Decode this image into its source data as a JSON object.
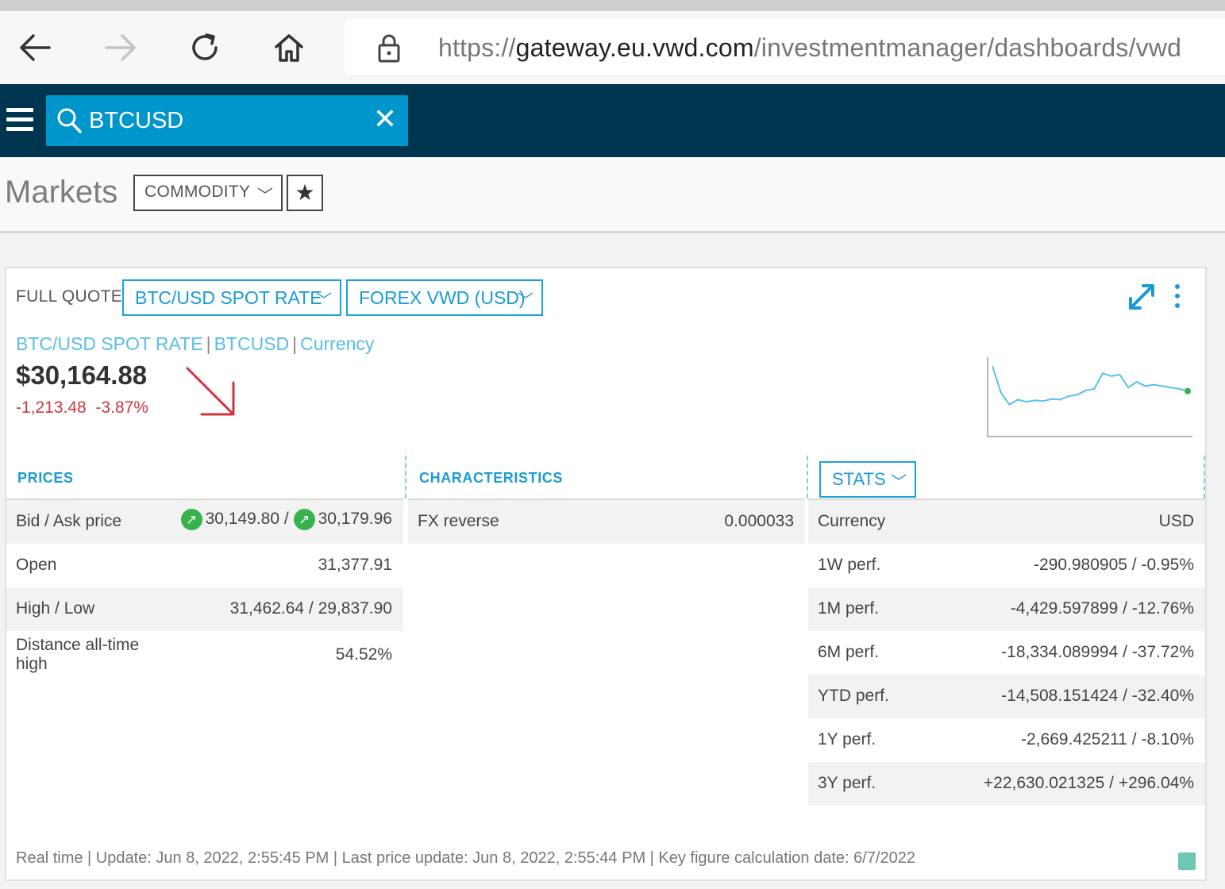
{
  "browser": {
    "url_scheme": "https://",
    "url_host": "gateway.eu.vwd.com",
    "url_path": "/investmentmanager/dashboards/vwd"
  },
  "appbar": {
    "search_value": "BTCUSD"
  },
  "markets": {
    "title": "Markets",
    "category": "COMMODITY"
  },
  "quote": {
    "label": "FULL QUOTE",
    "instrument_select": "BTC/USD SPOT RATE",
    "venue_select": "FOREX VWD (USD)",
    "link_name": "BTC/USD SPOT RATE",
    "link_symbol": "BTCUSD",
    "link_type": "Currency",
    "price": "$30,164.88",
    "change_abs": "-1,213.48",
    "change_pct": "-3.87%",
    "trend": "down",
    "colors": {
      "accent": "#1a9bd3",
      "negative": "#d0353d",
      "positive": "#37b24d",
      "appbar": "#003550",
      "search": "#0096cc"
    }
  },
  "sparkline": {
    "values": [
      0.92,
      0.55,
      0.38,
      0.45,
      0.42,
      0.44,
      0.43,
      0.46,
      0.45,
      0.5,
      0.52,
      0.58,
      0.6,
      0.82,
      0.78,
      0.8,
      0.62,
      0.7,
      0.64,
      0.66,
      0.64,
      0.62,
      0.6,
      0.57
    ]
  },
  "prices": {
    "heading": "PRICES",
    "bid_ask": {
      "label": "Bid / Ask price",
      "bid": "30,149.80",
      "sep": "/",
      "ask": "30,179.96"
    },
    "rows": [
      {
        "label": "Open",
        "value": "31,377.91"
      },
      {
        "label": "High / Low",
        "value": "31,462.64 / 29,837.90"
      },
      {
        "label": "Distance all-time high",
        "value": "54.52%"
      }
    ]
  },
  "characteristics": {
    "heading": "CHARACTERISTICS",
    "rows": [
      {
        "label": "FX reverse",
        "value": "0.000033"
      }
    ]
  },
  "stats": {
    "select": "STATS",
    "rows": [
      {
        "label": "Currency",
        "value": "USD"
      },
      {
        "label": "1W perf.",
        "value": "-290.980905 / -0.95%"
      },
      {
        "label": "1M perf.",
        "value": "-4,429.597899 / -12.76%"
      },
      {
        "label": "6M perf.",
        "value": "-18,334.089994 / -37.72%"
      },
      {
        "label": "YTD perf.",
        "value": "-14,508.151424 / -32.40%"
      },
      {
        "label": "1Y perf.",
        "value": "-2,669.425211 / -8.10%"
      },
      {
        "label": "3Y perf.",
        "value": "+22,630.021325 / +296.04%"
      }
    ]
  },
  "footer": {
    "text": "Real time | Update: Jun 8, 2022, 2:55:45 PM | Last price update: Jun 8, 2022, 2:55:44 PM | Key figure calculation date: 6/7/2022"
  }
}
